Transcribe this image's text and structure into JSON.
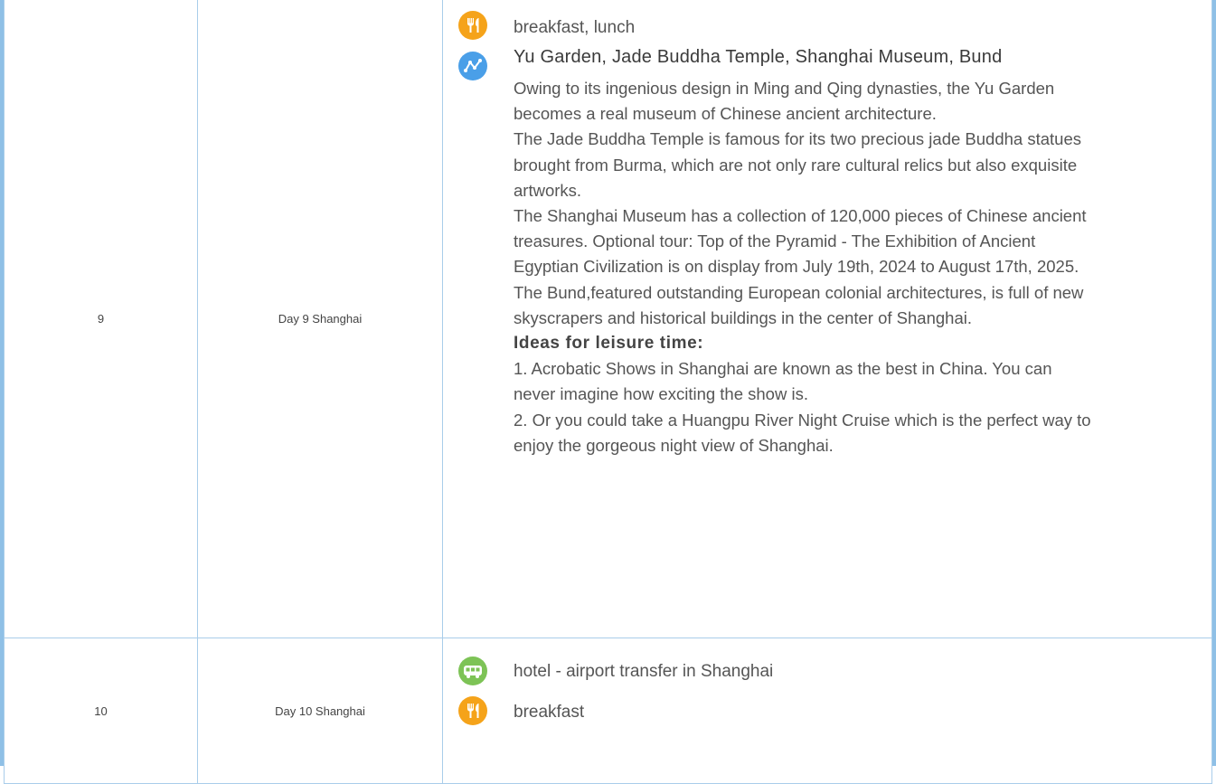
{
  "rows": [
    {
      "day": "9",
      "title": "Day 9 Shanghai",
      "meals": {
        "icon": "meal-icon",
        "text": "breakfast, lunch"
      },
      "sights": {
        "icon": "route-icon",
        "title": "Yu Garden, Jade Buddha Temple, Shanghai Museum, Bund",
        "paragraphs": [
          "Owing to its ingenious design in Ming and Qing dynasties, the Yu Garden becomes a real museum of Chinese ancient architecture.",
          "The Jade Buddha Temple is famous for its two precious jade Buddha statues brought from Burma, which are not only rare cultural relics but also exquisite artworks.",
          "The Shanghai Museum has a collection of 120,000 pieces of Chinese ancient treasures. Optional tour: Top of the Pyramid - The Exhibition of Ancient Egyptian Civilization is on display from July 19th, 2024 to August 17th, 2025.",
          "The Bund,featured outstanding European colonial architectures, is full of new skyscrapers and historical buildings in the center of Shanghai."
        ],
        "leisure_heading": "Ideas for leisure time:",
        "leisure_items": [
          "1. Acrobatic Shows in Shanghai are known as the best in China. You can never imagine how exciting the show is.",
          "2. Or you could take a Huangpu River Night Cruise which is the perfect way to enjoy the gorgeous night view of Shanghai."
        ]
      }
    },
    {
      "day": "10",
      "title": "Day 10 Shanghai",
      "transfer": {
        "icon": "bus-icon",
        "text": "hotel - airport transfer in Shanghai"
      },
      "meals": {
        "icon": "meal-icon",
        "text": "breakfast"
      }
    }
  ],
  "colors": {
    "meal_icon": "#f5a31a",
    "route_icon": "#4a9fe8",
    "bus_icon": "#7dc356",
    "border": "#a9cdea",
    "side_bar": "#8fc0e6"
  }
}
